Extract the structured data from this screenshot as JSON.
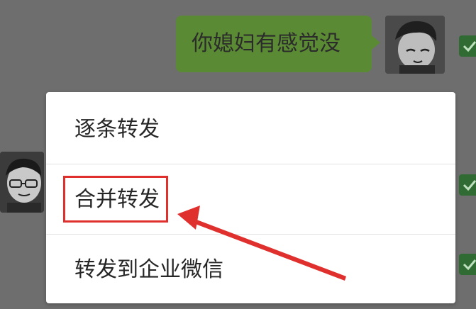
{
  "chat": {
    "sent_message": "你媳妇有感觉没"
  },
  "menu": {
    "items": [
      {
        "label": "逐条转发"
      },
      {
        "label": "合并转发"
      },
      {
        "label": "转发到企业微信"
      }
    ]
  },
  "colors": {
    "overlay_background": "#6e6e6e",
    "sent_bubble": "#5b8a34",
    "menu_background": "#ffffff",
    "highlight": "#e0302e",
    "checkbox": "#2f6b32"
  },
  "icons": {
    "avatar_me": "cartoon-boy-avatar",
    "avatar_other": "cartoon-glasses-avatar",
    "checkbox": "checkmark-icon",
    "annotation": "red-arrow"
  },
  "annotation": {
    "highlighted_item": "合并转发"
  }
}
